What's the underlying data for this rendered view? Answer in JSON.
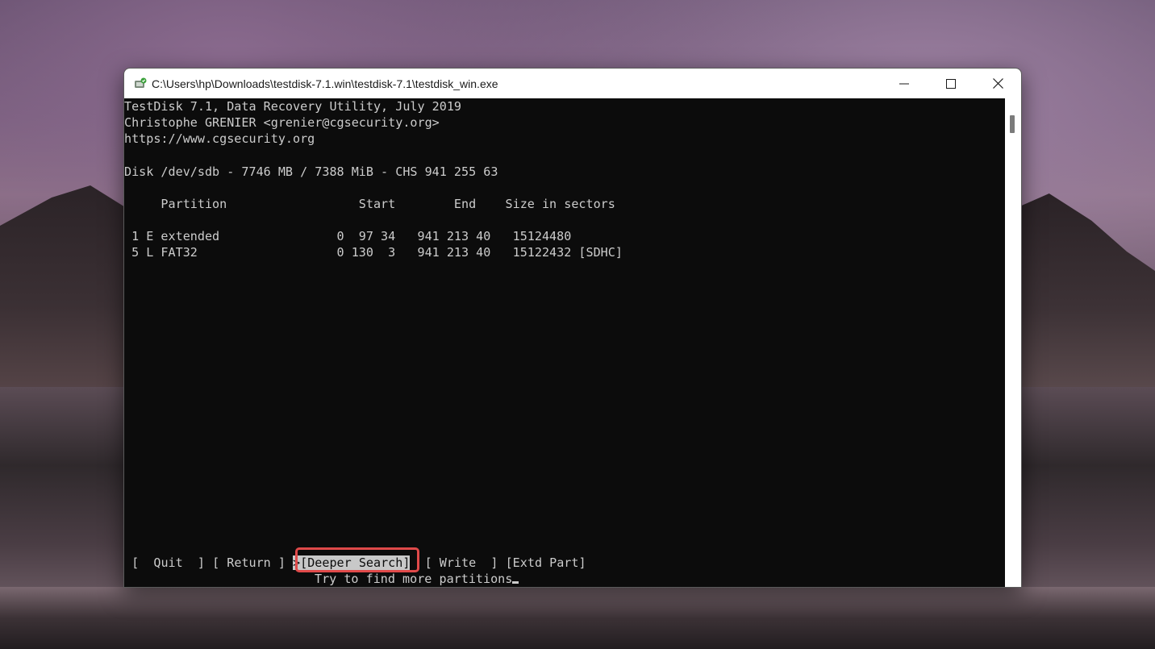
{
  "window": {
    "title": "C:\\Users\\hp\\Downloads\\testdisk-7.1.win\\testdisk-7.1\\testdisk_win.exe",
    "icon": "testdisk-app-icon",
    "controls": {
      "minimize_icon": "minimize-icon",
      "maximize_icon": "maximize-icon",
      "close_icon": "close-icon"
    }
  },
  "console": {
    "header_lines": [
      "TestDisk 7.1, Data Recovery Utility, July 2019",
      "Christophe GRENIER <grenier@cgsecurity.org>",
      "https://www.cgsecurity.org"
    ],
    "disk_line": "Disk /dev/sdb - 7746 MB / 7388 MiB - CHS 941 255 63",
    "table_header": "     Partition                  Start        End    Size in sectors",
    "partitions": [
      " 1 E extended                0  97 34   941 213 40   15124480",
      " 5 L FAT32                   0 130  3   941 213 40   15122432 [SDHC]"
    ],
    "menu": {
      "quit": "[  Quit  ]",
      "return": "[ Return ]",
      "deeper_search": ">[Deeper Search]",
      "write": "[ Write  ]",
      "extd_part": "[Extd Part]"
    },
    "hint": "Try to find more partitions"
  },
  "colors": {
    "console_bg": "#0c0c0c",
    "console_fg": "#cccccc",
    "highlight_border": "#e04a4a",
    "selected_bg": "#c8c8c8"
  }
}
